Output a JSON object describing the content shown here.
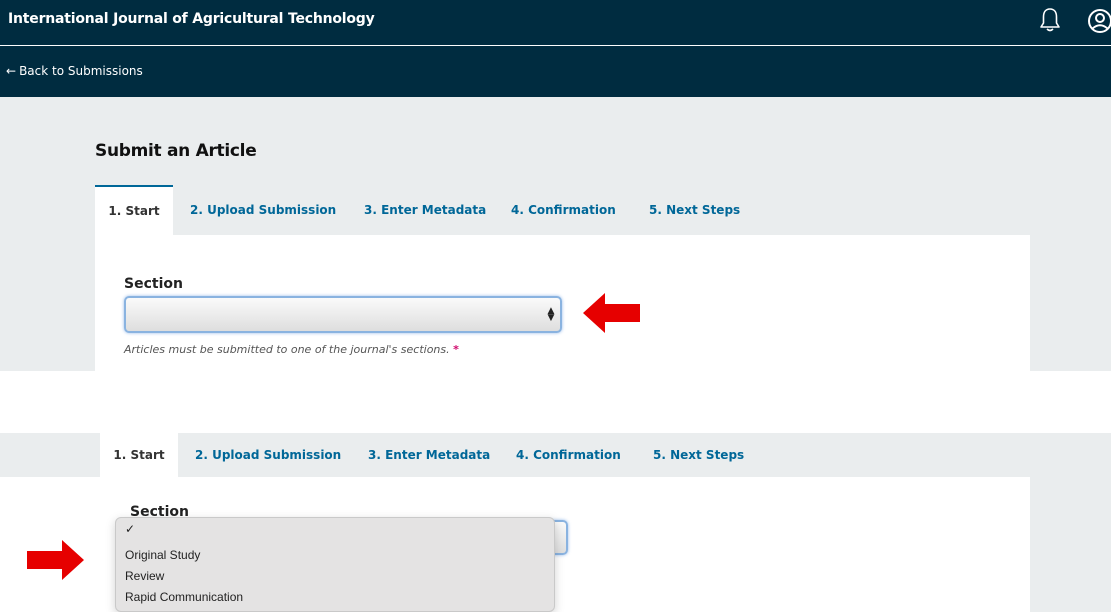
{
  "header": {
    "site_title": "International Journal of Agricultural Technology",
    "bell_icon": "bell-icon",
    "user_icon": "user-icon",
    "back_arrow": "←",
    "back_label": "Back to Submissions",
    "bar_color": "#002c40"
  },
  "page": {
    "title": "Submit an Article"
  },
  "tabs": [
    {
      "label": "1. Start",
      "active": true
    },
    {
      "label": "2. Upload Submission",
      "active": false
    },
    {
      "label": "3. Enter Metadata",
      "active": false
    },
    {
      "label": "4. Confirmation",
      "active": false
    },
    {
      "label": "5. Next Steps",
      "active": false
    }
  ],
  "form": {
    "section_label": "Section",
    "section_value": "",
    "section_hint": "Articles must be submitted to one of the journal's sections.",
    "required_marker": "*"
  },
  "dropdown": {
    "check_mark": "✓",
    "options": [
      "Original Study",
      "Review",
      "Rapid Communication"
    ]
  },
  "colors": {
    "link": "#006798",
    "annotation_arrow": "#e60000",
    "required": "#d00b6d"
  }
}
